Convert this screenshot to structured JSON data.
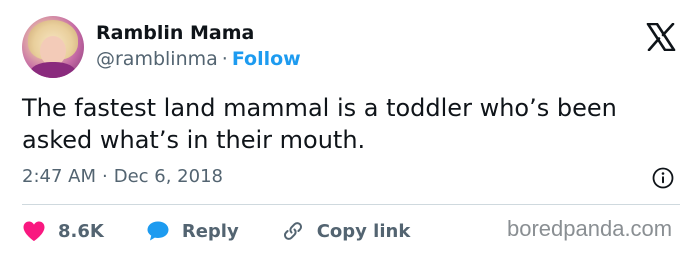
{
  "author": {
    "display_name": "Ramblin Mama",
    "handle": "@ramblinma",
    "separator": "·",
    "follow_label": "Follow"
  },
  "tweet": {
    "text": "The fastest land mammal is a toddler who’s been asked what’s in their mouth.",
    "time": "2:47 AM",
    "separator": "·",
    "date": "Dec 6, 2018"
  },
  "actions": {
    "likes": "8.6K",
    "reply_label": "Reply",
    "copy_label": "Copy link"
  },
  "icons": {
    "logo": "x-logo-icon",
    "info": "info-icon",
    "like": "heart-icon",
    "reply": "speech-bubble-icon",
    "copy": "link-icon"
  },
  "colors": {
    "accent": "#1d9bf0",
    "like": "#f91880",
    "text": "#0f1419",
    "muted": "#536471"
  },
  "watermark": "boredpanda.com"
}
